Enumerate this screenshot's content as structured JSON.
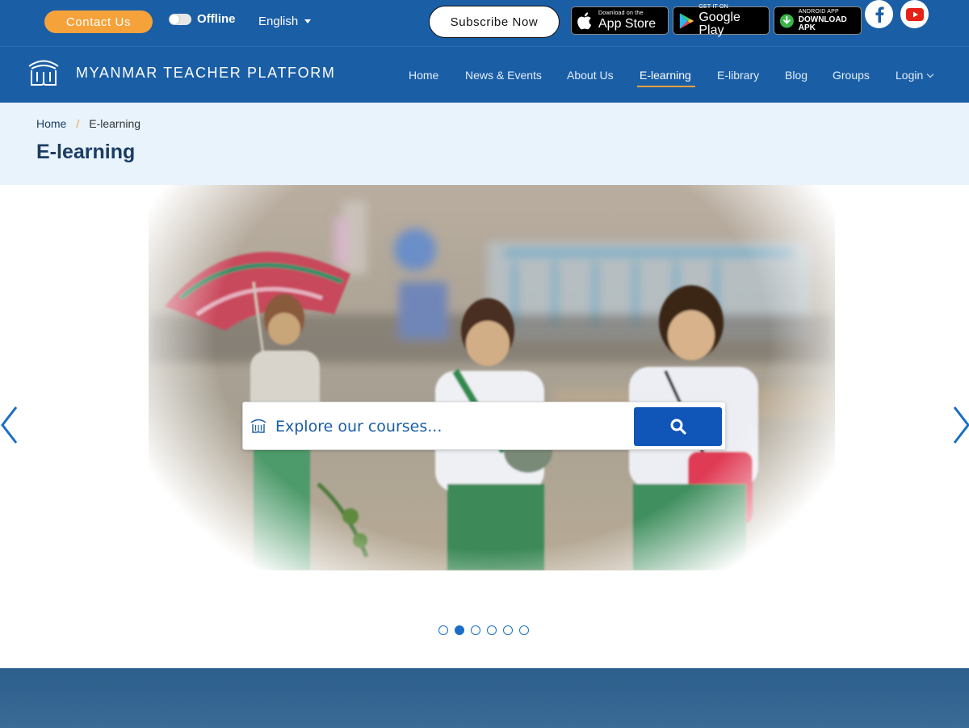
{
  "topbar": {
    "contact_label": "Contact Us",
    "offline_label": "Offline",
    "language": "English",
    "subscribe_label": "Subscribe Now",
    "app_store": {
      "small": "Download on the",
      "big": "App Store"
    },
    "google_play": {
      "small": "GET IT ON",
      "big": "Google Play"
    },
    "apk": {
      "small": "ANDROID APP",
      "big": "DOWNLOAD APK"
    },
    "social": [
      "facebook-icon",
      "youtube-icon"
    ]
  },
  "navbar": {
    "brand": "MYANMAR TEACHER PLATFORM",
    "items": [
      {
        "label": "Home"
      },
      {
        "label": "News & Events"
      },
      {
        "label": "About Us"
      },
      {
        "label": "E-learning",
        "active": true
      },
      {
        "label": "E-library"
      },
      {
        "label": "Blog"
      },
      {
        "label": "Groups"
      },
      {
        "label": "Login"
      }
    ],
    "accent": "#f6a23a"
  },
  "breadcrumb": {
    "home": "Home",
    "separator": "/",
    "current": "E-learning"
  },
  "page_title": "E-learning",
  "hero": {
    "search_placeholder": "Explore our courses...",
    "slide_count": 6,
    "active_slide": 2
  },
  "colors": {
    "primary": "#1a5ea6",
    "accent": "#f6a23a",
    "band": "#e8f3fc",
    "search_button": "#0f56b8"
  }
}
